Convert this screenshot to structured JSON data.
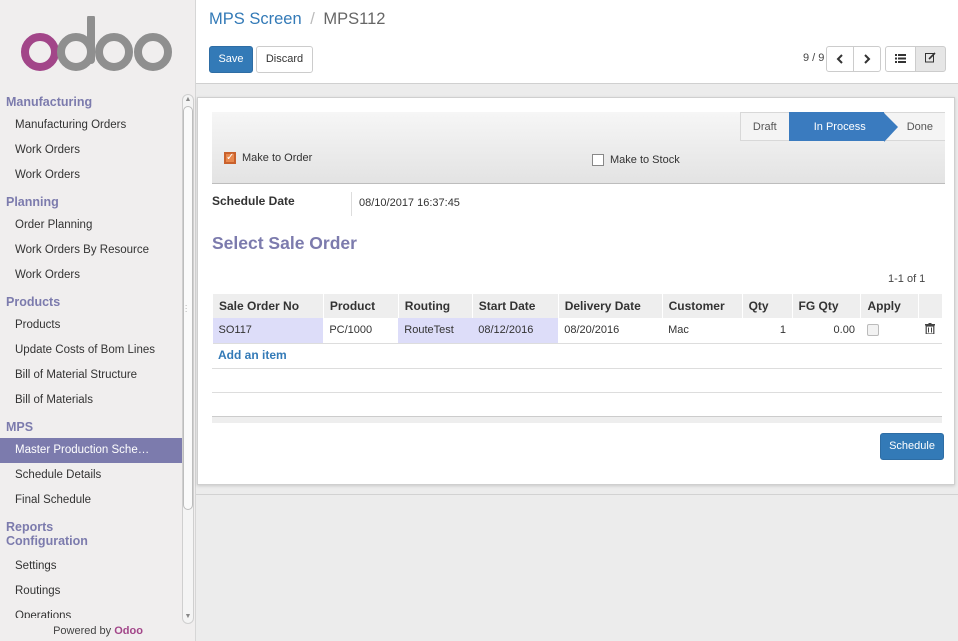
{
  "logo": {
    "text": "odoo"
  },
  "sidebar": {
    "sections": [
      {
        "label": "Manufacturing",
        "items": [
          "Manufacturing Orders",
          "Work Orders",
          "Work Orders"
        ]
      },
      {
        "label": "Planning",
        "items": [
          "Order Planning",
          "Work Orders By Resource",
          "Work Orders"
        ]
      },
      {
        "label": "Products",
        "items": [
          "Products",
          "Update Costs of Bom Lines",
          "Bill of Material Structure",
          "Bill of Materials"
        ]
      },
      {
        "label": "MPS",
        "items": [
          "Master Production Sche…",
          "Schedule Details",
          "Final Schedule"
        ]
      },
      {
        "label": "Reports",
        "items": []
      },
      {
        "label": "Configuration",
        "items": [
          "Settings",
          "Routings",
          "Operations"
        ]
      }
    ],
    "active_item": "Master Production Sche…",
    "powered_prefix": "Powered by",
    "powered_brand": "Odoo"
  },
  "breadcrumb": {
    "parent": "MPS Screen",
    "separator": "/",
    "current": "MPS112"
  },
  "toolbar": {
    "save_label": "Save",
    "discard_label": "Discard"
  },
  "pager": {
    "value": "9 / 9",
    "prev_icon": "‹",
    "next_icon": "›"
  },
  "views": {
    "list_icon": "list-icon",
    "form_icon": "edit-icon"
  },
  "statusbar": {
    "stages": [
      "Draft",
      "In Process",
      "Done"
    ],
    "current": "In Process"
  },
  "checkboxes": {
    "make_to_order": {
      "label": "Make to Order",
      "checked": true
    },
    "make_to_stock": {
      "label": "Make to Stock",
      "checked": false
    }
  },
  "form": {
    "schedule_date_label": "Schedule Date",
    "schedule_date_value": "08/10/2017 16:37:45",
    "section_title": "Select Sale Order",
    "record_pager": "1-1 of 1"
  },
  "table": {
    "columns": [
      "Sale Order No",
      "Product",
      "Routing",
      "Start Date",
      "Delivery Date",
      "Customer",
      "Qty",
      "FG Qty",
      "Apply"
    ],
    "rows": [
      {
        "sale_order_no": "SO117",
        "product": "PC/1000",
        "routing": "RouteTest",
        "start_date": "08/12/2016",
        "delivery_date": "08/20/2016",
        "customer": "Mac",
        "qty": "1",
        "fg_qty": "0.00",
        "apply": false
      }
    ],
    "add_item_label": "Add an item"
  },
  "actions": {
    "schedule_label": "Schedule"
  },
  "colors": {
    "brand_purple": "#7c7bad",
    "primary_blue": "#337ab7",
    "highlight_cell": "#ddddf9"
  }
}
